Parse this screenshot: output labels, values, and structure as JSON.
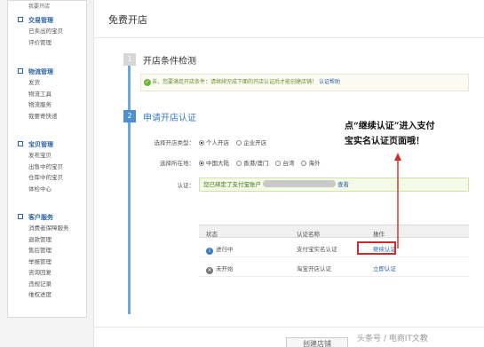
{
  "sidebar": {
    "top_cut": "我要开店",
    "groups": [
      {
        "title": "交易管理",
        "items": [
          "已卖出的宝贝",
          "评价管理"
        ]
      },
      {
        "title": "物流管理",
        "items": [
          "发货",
          "物流工具",
          "物流服务",
          "我要寄快递"
        ]
      },
      {
        "title": "宝贝管理",
        "items": [
          "发布宝贝",
          "出售中的宝贝",
          "仓库中的宝贝",
          "体检中心"
        ]
      },
      {
        "title": "客户服务",
        "items": [
          "消费者保障服务",
          "退款管理",
          "售后管理",
          "举报管理",
          "咨询回复",
          "违规记录",
          "维权进度"
        ]
      }
    ]
  },
  "page": {
    "title": "免费开店",
    "step1": {
      "number": "1",
      "title": "开店条件检测"
    },
    "notice": {
      "text": "亲，您要满足开店条件：请继续完成下面的开店认证后才能创建店铺！",
      "help_link": "认证帮助"
    },
    "step2": {
      "number": "2",
      "title": "申请开店认证"
    },
    "form": {
      "shop_type_label": "选择开店类型：",
      "shop_type_options": [
        "个人开店",
        "企业开店"
      ],
      "region_label": "选择所在地：",
      "region_options": [
        "中国大陆",
        "香港/澳门",
        "台湾",
        "海外"
      ],
      "cert_label": "认证：",
      "cert_text": "您已绑定了支付宝账户",
      "cert_link": "查看"
    },
    "table": {
      "headers": [
        "状态",
        "认证名称",
        "操作"
      ],
      "rows": [
        {
          "status": "进行中",
          "name": "支付宝实名认证",
          "action": "继续认证"
        },
        {
          "status": "未开始",
          "name": "淘宝开店认证",
          "action": "立即认证"
        }
      ]
    },
    "create_button": "创建店铺"
  },
  "annotation": {
    "line1": "点“继续认证”进入支付",
    "line2": "宝实名认证页面哦！"
  },
  "watermark": "头条号 / 电商IT文教",
  "colors": {
    "accent_blue": "#3b7cc0",
    "annotation_red": "#d02a2a",
    "notice_green": "#6a8d32"
  }
}
